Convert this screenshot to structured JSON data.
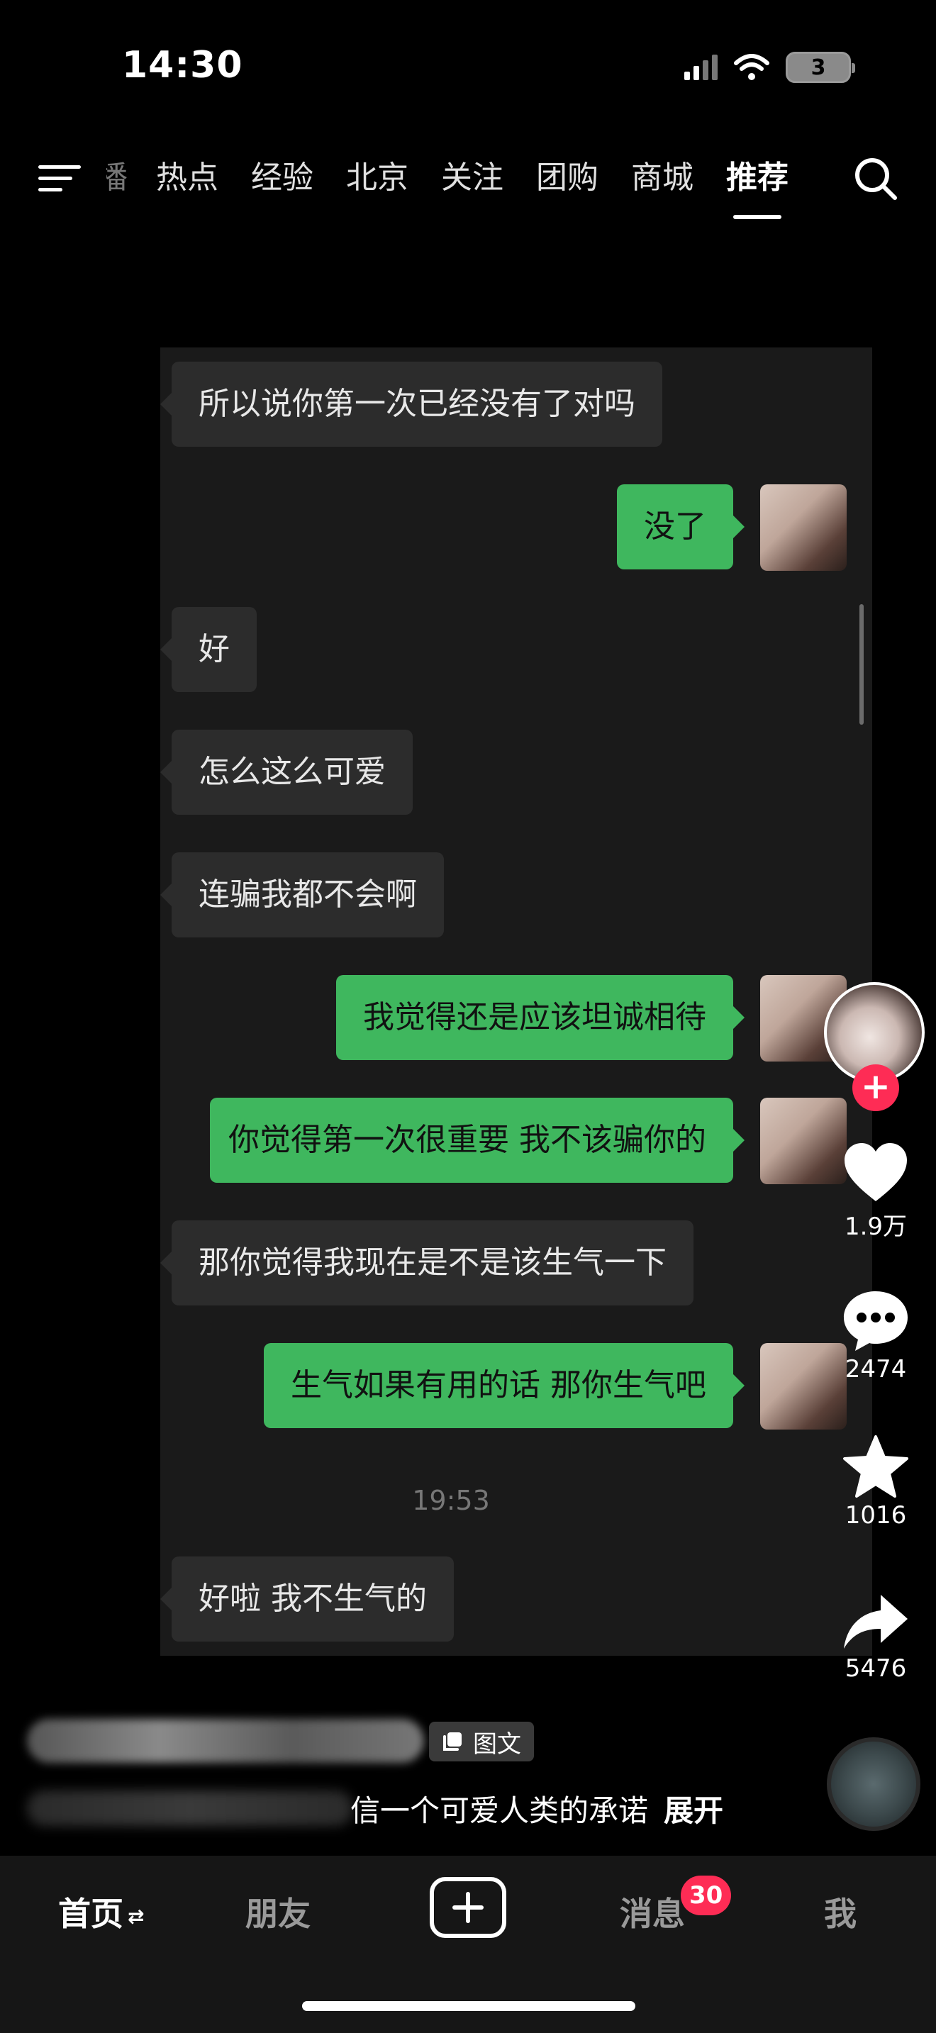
{
  "status_bar": {
    "time": "14:30",
    "battery": "3"
  },
  "top_tabs": {
    "partial_tab": "直播",
    "items": [
      "热点",
      "经验",
      "北京",
      "关注",
      "团购",
      "商城",
      "推荐"
    ],
    "active": "推荐"
  },
  "chat": {
    "messages": [
      {
        "side": "in",
        "text": "所以说你第一次已经没有了对吗"
      },
      {
        "side": "out",
        "text": "没了"
      },
      {
        "side": "in",
        "text": "好"
      },
      {
        "side": "in",
        "text": "怎么这么可爱"
      },
      {
        "side": "in",
        "text": "连骗我都不会啊"
      },
      {
        "side": "out",
        "text": "我觉得还是应该坦诚相待"
      },
      {
        "side": "out",
        "text": "你觉得第一次很重要  我不该骗你的"
      },
      {
        "side": "in",
        "text": "那你觉得我现在是不是该生气一下"
      },
      {
        "side": "out",
        "text": "生气如果有用的话 那你生气吧"
      },
      {
        "side": "in",
        "text": "好啦 我不生气的"
      }
    ],
    "timestamp": "19:53"
  },
  "actions": {
    "follow": "+",
    "likes": "1.9万",
    "comments": "2474",
    "favorites": "1016",
    "shares": "5476"
  },
  "post": {
    "type_badge": "图文",
    "caption": "信一个可爱人类的承诺",
    "expand": "展开"
  },
  "bottom_nav": {
    "home": "首页",
    "friends": "朋友",
    "messages": "消息",
    "messages_badge": "30",
    "me": "我"
  }
}
